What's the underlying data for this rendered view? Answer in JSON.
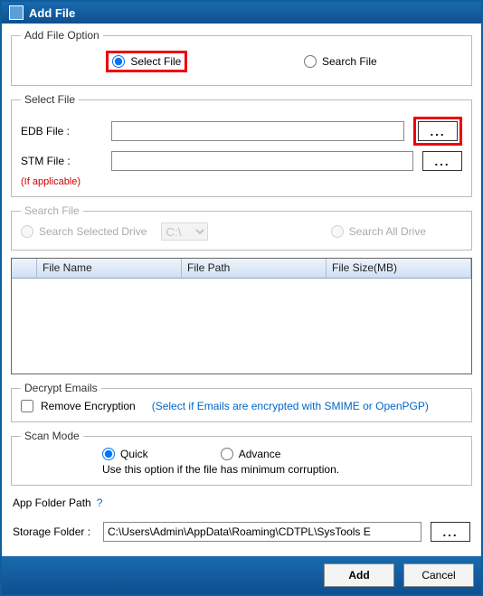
{
  "title": "Add File",
  "addFileOption": {
    "legend": "Add File Option",
    "selectFile": "Select File",
    "searchFile": "Search File"
  },
  "selectFile": {
    "legend": "Select File",
    "edbLabel": "EDB File :",
    "edbValue": "",
    "stmLabel": "STM File :",
    "stmValue": "",
    "stmHint": "(If applicable)",
    "browse": "..."
  },
  "searchFile": {
    "legend": "Search File",
    "selectedDrive": "Search Selected Drive",
    "driveValue": "C:\\",
    "allDrive": "Search All Drive"
  },
  "grid": {
    "col1": "File Name",
    "col2": "File Path",
    "col3": "File Size(MB)"
  },
  "decrypt": {
    "legend": "Decrypt Emails",
    "checkbox": "Remove Encryption",
    "hint": "(Select if Emails are encrypted with SMIME or OpenPGP)"
  },
  "scan": {
    "legend": "Scan Mode",
    "quick": "Quick",
    "advance": "Advance",
    "hint": "Use this option if the file has minimum corruption."
  },
  "appFolder": {
    "label": "App Folder Path",
    "help": "?"
  },
  "storage": {
    "label": "Storage Folder   :",
    "value": "C:\\Users\\Admin\\AppData\\Roaming\\CDTPL\\SysTools E",
    "browse": "..."
  },
  "footer": {
    "add": "Add",
    "cancel": "Cancel"
  }
}
